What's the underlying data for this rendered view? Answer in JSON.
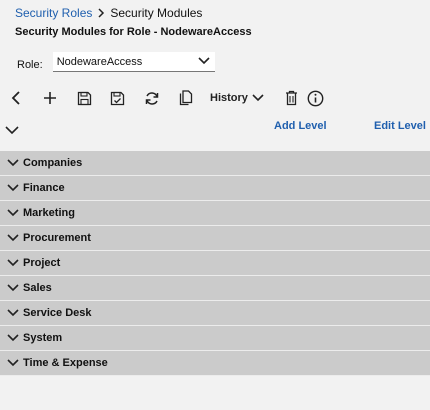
{
  "breadcrumb": {
    "parent": "Security Roles",
    "current": "Security Modules"
  },
  "page": {
    "title": "Security Modules for Role - NodewareAccess"
  },
  "role": {
    "label": "Role:",
    "value": "NodewareAccess"
  },
  "toolbar": {
    "history_label": "History",
    "icons": [
      "back-icon",
      "add-icon",
      "save-icon",
      "save-and-close-icon",
      "refresh-icon",
      "copy-icon",
      "chevron-down-icon",
      "trash-icon",
      "info-icon"
    ]
  },
  "levels": {
    "add_label": "Add Level",
    "edit_label": "Edit Level"
  },
  "modules": [
    {
      "label": "Companies"
    },
    {
      "label": "Finance"
    },
    {
      "label": "Marketing"
    },
    {
      "label": "Procurement"
    },
    {
      "label": "Project"
    },
    {
      "label": "Sales"
    },
    {
      "label": "Service Desk"
    },
    {
      "label": "System"
    },
    {
      "label": "Time & Expense"
    }
  ],
  "colors": {
    "link": "#1f5fae",
    "module_row_bg": "#cbcbcb",
    "page_bg": "#f2f2f2"
  }
}
